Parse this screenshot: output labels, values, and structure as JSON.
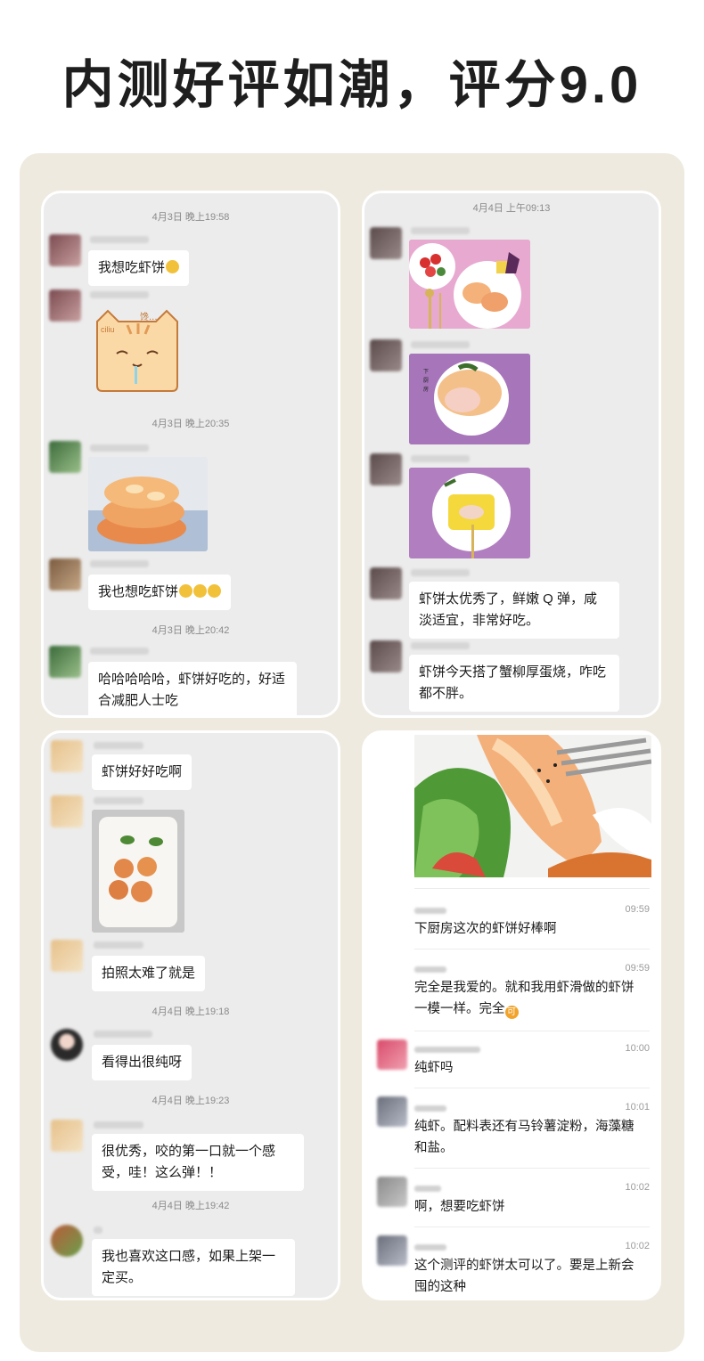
{
  "headline": "内测好评如潮，评分9.0",
  "panel1": {
    "ts1": "4月3日 晚上19:58",
    "msg1": "我想吃虾饼",
    "ts2": "4月3日 晚上20:35",
    "msg2": "我也想吃虾饼",
    "ts3": "4月3日 晚上20:42",
    "msg3": "哈哈哈哈哈，虾饼好吃的，好适合减肥人士吃",
    "sticker_text_a": "ciliu",
    "sticker_text_b": "馋..."
  },
  "panel2": {
    "ts1": "4月4日 上午09:13",
    "msg1": "虾饼太优秀了，鲜嫩 Q 弹，咸淡适宜，非常好吃。",
    "msg2": "虾饼今天搭了蟹柳厚蛋烧，咋吃都不胖。"
  },
  "panel3": {
    "msg1": "虾饼好好吃啊",
    "msg2": "拍照太难了就是",
    "ts1": "4月4日 晚上19:18",
    "msg3": "看得出很纯呀",
    "ts2": "4月4日 晚上19:23",
    "msg4": "很优秀，咬的第一口就一个感受，哇！这么弹！！",
    "ts3": "4月4日 晚上19:42",
    "msg5": "我也喜欢这口感，如果上架一定买。"
  },
  "panel4": {
    "comments": [
      {
        "time": "09:59",
        "text": "下厨房这次的虾饼好棒啊"
      },
      {
        "time": "09:59",
        "text": "完全是我爱的。就和我用虾滑做的虾饼一模一样。完全",
        "coin": "可"
      },
      {
        "time": "10:00",
        "text": "纯虾吗"
      },
      {
        "time": "10:01",
        "text": "纯虾。配料表还有马铃薯淀粉，海藻糖和盐。"
      },
      {
        "time": "10:02",
        "text": "啊，想要吃虾饼"
      },
      {
        "time": "10:02",
        "text": "这个测评的虾饼太可以了。要是上新会囤的这种"
      }
    ]
  },
  "colors": {
    "board": "#eeeadf",
    "panel": "#ececec",
    "accent": "#e07a3a"
  }
}
